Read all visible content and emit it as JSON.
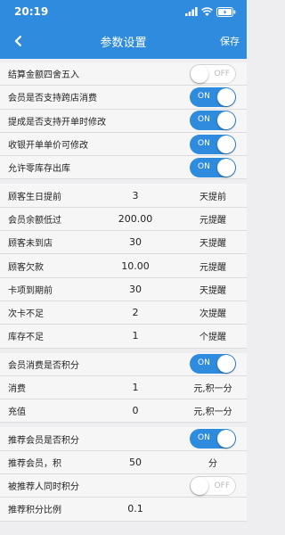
{
  "status": {
    "time": "20:19"
  },
  "nav": {
    "title": "参数设置",
    "save": "保存"
  },
  "switch_text": {
    "on": "ON",
    "off": "OFF"
  },
  "toggles_top": [
    {
      "label": "结算金额四舍五入",
      "on": false
    },
    {
      "label": "会员是否支持跨店消费",
      "on": true
    },
    {
      "label": "提成是否支持开单时修改",
      "on": true
    },
    {
      "label": "收银开单单价可修改",
      "on": true
    },
    {
      "label": "允许零库存出库",
      "on": true
    }
  ],
  "reminders": [
    {
      "label": "顾客生日提前",
      "value": "3",
      "unit": "天提前"
    },
    {
      "label": "会员余额低过",
      "value": "200.00",
      "unit": "元提醒"
    },
    {
      "label": "顾客未到店",
      "value": "30",
      "unit": "天提醒"
    },
    {
      "label": "顾客欠款",
      "value": "10.00",
      "unit": "元提醒"
    },
    {
      "label": "卡项到期前",
      "value": "30",
      "unit": "天提醒"
    },
    {
      "label": "次卡不足",
      "value": "2",
      "unit": "次提醒"
    },
    {
      "label": "库存不足",
      "value": "1",
      "unit": "个提醒"
    }
  ],
  "member_points": {
    "toggle": {
      "label": "会员消费是否积分",
      "on": true
    },
    "rows": [
      {
        "label": "消费",
        "value": "1",
        "unit": "元,积一分"
      },
      {
        "label": "充值",
        "value": "0",
        "unit": "元,积一分"
      }
    ]
  },
  "referral": {
    "toggle": {
      "label": "推荐会员是否积分",
      "on": true
    },
    "row": {
      "label": "推荐会员，积",
      "value": "50",
      "unit": "分"
    },
    "toggle2": {
      "label": "被推荐人同时积分",
      "on": false
    },
    "ratio": {
      "label": "推荐积分比例",
      "value": "0.1",
      "unit": ""
    }
  }
}
